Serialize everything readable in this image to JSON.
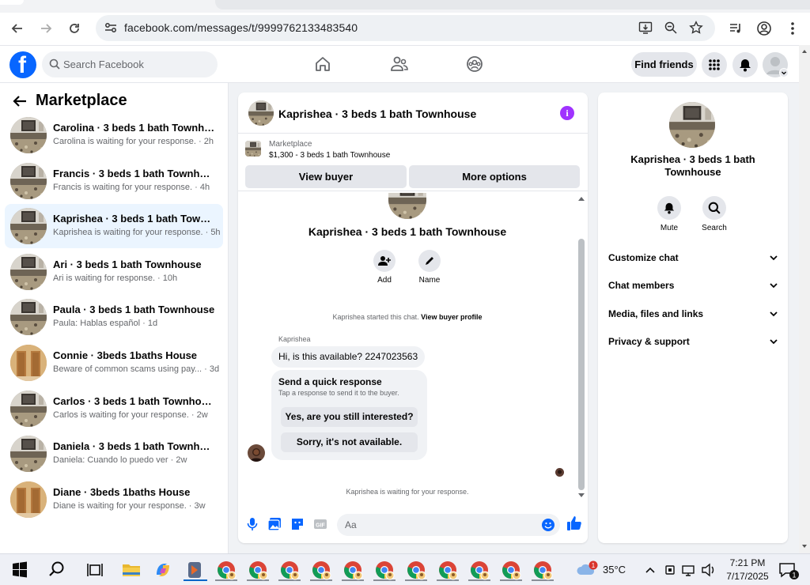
{
  "browser": {
    "url": "facebook.com/messages/t/9999762133483540"
  },
  "fb": {
    "search_placeholder": "Search Facebook",
    "find_friends": "Find friends"
  },
  "marketplace": {
    "title": "Marketplace",
    "conversations": [
      {
        "name": "Carolina · 3 beds 1 bath Townhouse",
        "sub": "Carolina is waiting for your response. · 2h",
        "selected": false,
        "thumb": "townhouse"
      },
      {
        "name": "Francis · 3 beds 1 bath Townhouse",
        "sub": "Francis is waiting for your response. · 4h",
        "selected": false,
        "thumb": "townhouse"
      },
      {
        "name": "Kaprishea · 3 beds 1 bath Townhou...",
        "sub": "Kaprishea is waiting for your response. · 5h",
        "selected": true,
        "thumb": "townhouse"
      },
      {
        "name": "Ari · 3 beds 1 bath Townhouse",
        "sub": "Ari is waiting for response. · 10h",
        "selected": false,
        "thumb": "townhouse"
      },
      {
        "name": "Paula · 3 beds 1 bath Townhouse",
        "sub": "Paula: Hablas español · 1d",
        "selected": false,
        "thumb": "townhouse"
      },
      {
        "name": "Connie · 3beds 1baths House",
        "sub": "Beware of common scams using pay...  · 3d",
        "selected": false,
        "thumb": "house"
      },
      {
        "name": "Carlos · 3 beds 1 bath Townhouse",
        "sub": "Carlos is waiting for your response. · 2w",
        "selected": false,
        "thumb": "townhouse"
      },
      {
        "name": "Daniela · 3 beds 1 bath Townhouse",
        "sub": "Daniela: Cuando lo puedo ver · 2w",
        "selected": false,
        "thumb": "townhouse"
      },
      {
        "name": "Diane · 3beds 1baths House",
        "sub": "Diane is waiting for your response. · 3w",
        "selected": false,
        "thumb": "house"
      }
    ]
  },
  "chat": {
    "title": "Kaprishea · 3 beds 1 bath Townhouse",
    "marketplace_label": "Marketplace",
    "listing": "$1,300 - 3 beds 1 bath Townhouse",
    "view_buyer": "View buyer",
    "more_options": "More options",
    "profile_name": "Kaprishea · 3 beds 1 bath Townhouse",
    "add_label": "Add",
    "name_label": "Name",
    "started_text": "Kaprishea started this chat.",
    "view_profile": "View buyer profile",
    "sender": "Kaprishea",
    "message": "Hi, is this available? 2247023563",
    "quick_title": "Send a quick response",
    "quick_sub": "Tap a response to send it to the buyer.",
    "quick_1": "Yes, are you still interested?",
    "quick_2": "Sorry, it's not available.",
    "waiting": "Kaprishea is waiting for your response.",
    "composer_placeholder": "Aa"
  },
  "info": {
    "name": "Kaprishea · 3 beds 1 bath Townhouse",
    "mute": "Mute",
    "search": "Search",
    "sections": [
      "Customize chat",
      "Chat members",
      "Media, files and links",
      "Privacy & support"
    ]
  },
  "taskbar": {
    "temperature": "35°C",
    "time": "7:21 PM",
    "date": "7/17/2025",
    "weather_badge": "1",
    "notif_count": "1"
  },
  "colors": {
    "fb_blue": "#0866ff",
    "selected_bg": "#ebf5ff",
    "info_purple": "#a033ff"
  }
}
